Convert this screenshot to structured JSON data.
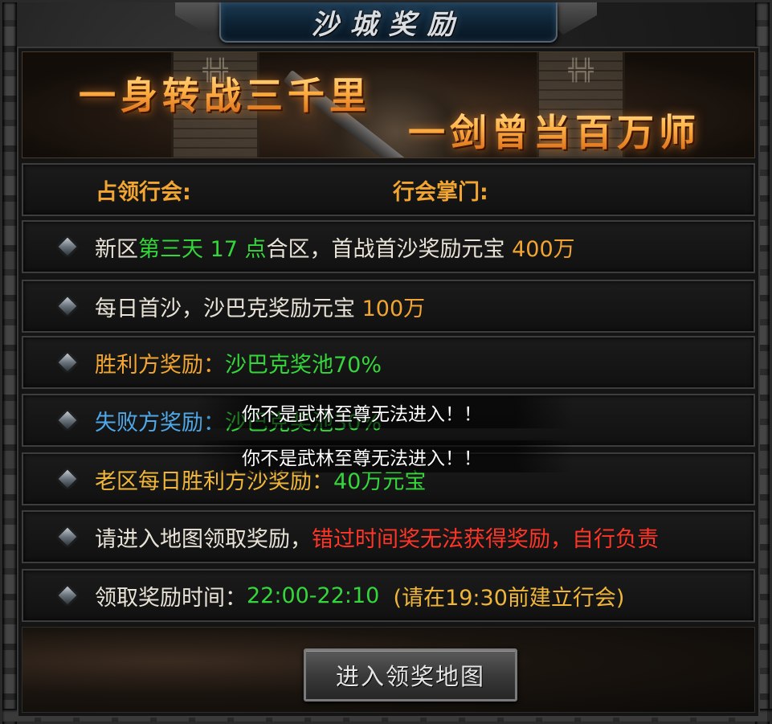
{
  "title": "沙城奖励",
  "banner": {
    "line1": "一身转战三千里",
    "line2": "一剑曾当百万师"
  },
  "guild_row": {
    "occupying_guild_label": "占领行会:",
    "guild_leader_label": "行会掌门:"
  },
  "rows": [
    {
      "segments": [
        {
          "text": "新区",
          "color": "white"
        },
        {
          "text": "第三天 17 点",
          "color": "green"
        },
        {
          "text": "合区，首战首沙奖励元宝 ",
          "color": "white"
        },
        {
          "text": "400万",
          "color": "orange"
        }
      ]
    },
    {
      "segments": [
        {
          "text": "每日首沙，沙巴克奖励元宝 ",
          "color": "white"
        },
        {
          "text": "100万",
          "color": "orange"
        }
      ]
    },
    {
      "segments": [
        {
          "text": "胜利方奖励：",
          "color": "orange"
        },
        {
          "text": "沙巴克奖池70%",
          "color": "green"
        }
      ]
    },
    {
      "segments": [
        {
          "text": "失败方奖励：",
          "color": "blue"
        },
        {
          "text": "沙巴克奖池30%",
          "color": "green"
        }
      ]
    },
    {
      "segments": [
        {
          "text": "老区每日胜利方沙奖励：",
          "color": "yellow"
        },
        {
          "text": "40万元宝",
          "color": "green"
        }
      ]
    },
    {
      "segments": [
        {
          "text": "请进入地图领取奖励，",
          "color": "white"
        },
        {
          "text": "错过时间奖无法获得奖励，自行负责",
          "color": "red"
        }
      ]
    },
    {
      "segments": [
        {
          "text": "领取奖励时间：",
          "color": "white"
        },
        {
          "text": "22:00-22:10",
          "color": "green"
        },
        {
          "text": "  (请在19:30前建立行会)",
          "color": "yellow"
        }
      ]
    }
  ],
  "button": {
    "label": "进入领奖地图"
  },
  "toasts": [
    "你不是武林至尊无法进入！！",
    "你不是武林至尊无法进入！！"
  ],
  "colors": {
    "white": "#e8e3d6",
    "green": "#35d63b",
    "orange": "#f2a531",
    "blue": "#4fa8e8",
    "red": "#ff3527",
    "yellow": "#f0b63a"
  },
  "icons": {
    "row_bullet": "diamond-bullet-icon"
  }
}
